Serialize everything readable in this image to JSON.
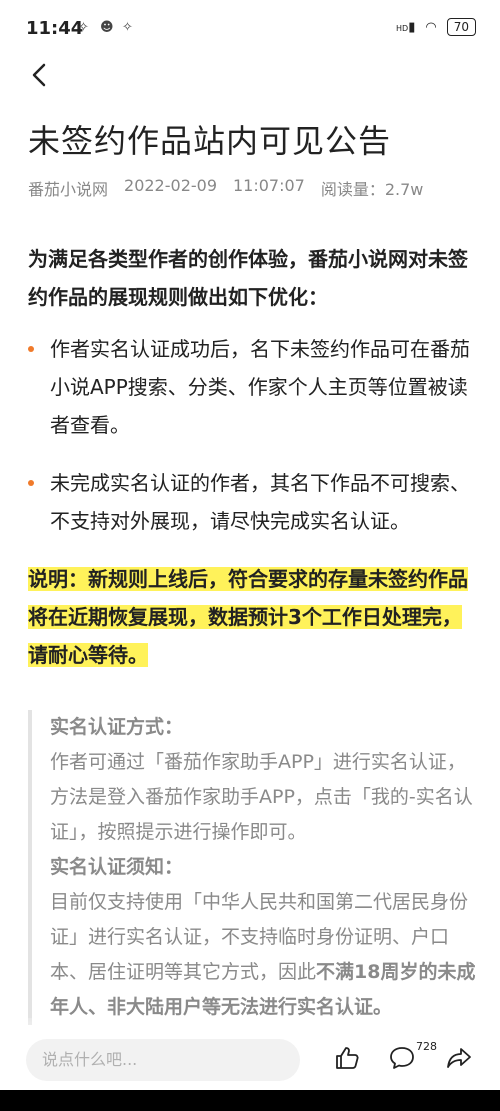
{
  "status": {
    "time": "11:44",
    "battery": "70",
    "network": "HD"
  },
  "article": {
    "title": "未签约作品站内可见公告",
    "source": "番茄小说网",
    "date": "2022-02-09",
    "time": "11:07:07",
    "reads": "阅读量：2.7w",
    "intro": "为满足各类型作者的创作体验，番茄小说网对未签约作品的展现规则做出如下优化：",
    "bullets": [
      "作者实名认证成功后，名下未签约作品可在番茄小说APP搜索、分类、作家个人主页等位置被读者查看。",
      "未完成实名认证的作者，其名下作品不可搜索、不支持对外展现，请尽快完成实名认证。"
    ],
    "note": "说明：新规则上线后，符合要求的存量未签约作品将在近期恢复展现，数据预计3个工作日处理完，请耐心等待。",
    "quote": {
      "heading1": "实名认证方式：",
      "text1": "作者可通过「番茄作家助手APP」进行实名认证，方法是登入番茄作家助手APP，点击「我的-实名认证」，按照提示进行操作即可。",
      "heading2": "实名认证须知：",
      "text2": "目前仅支持使用「中华人民共和国第二代居民身份证」进行实名认证，不支持临时身份证明、户口本、居住证明等其它方式，因此",
      "text2_bold": "不满18周岁的未成年人、非大陆用户等无法进行实名认证。"
    }
  },
  "bottom": {
    "placeholder": "说点什么吧...",
    "comment_count": "728"
  },
  "colors": {
    "bullet": "#f07a2a",
    "highlight": "#fff25a"
  }
}
